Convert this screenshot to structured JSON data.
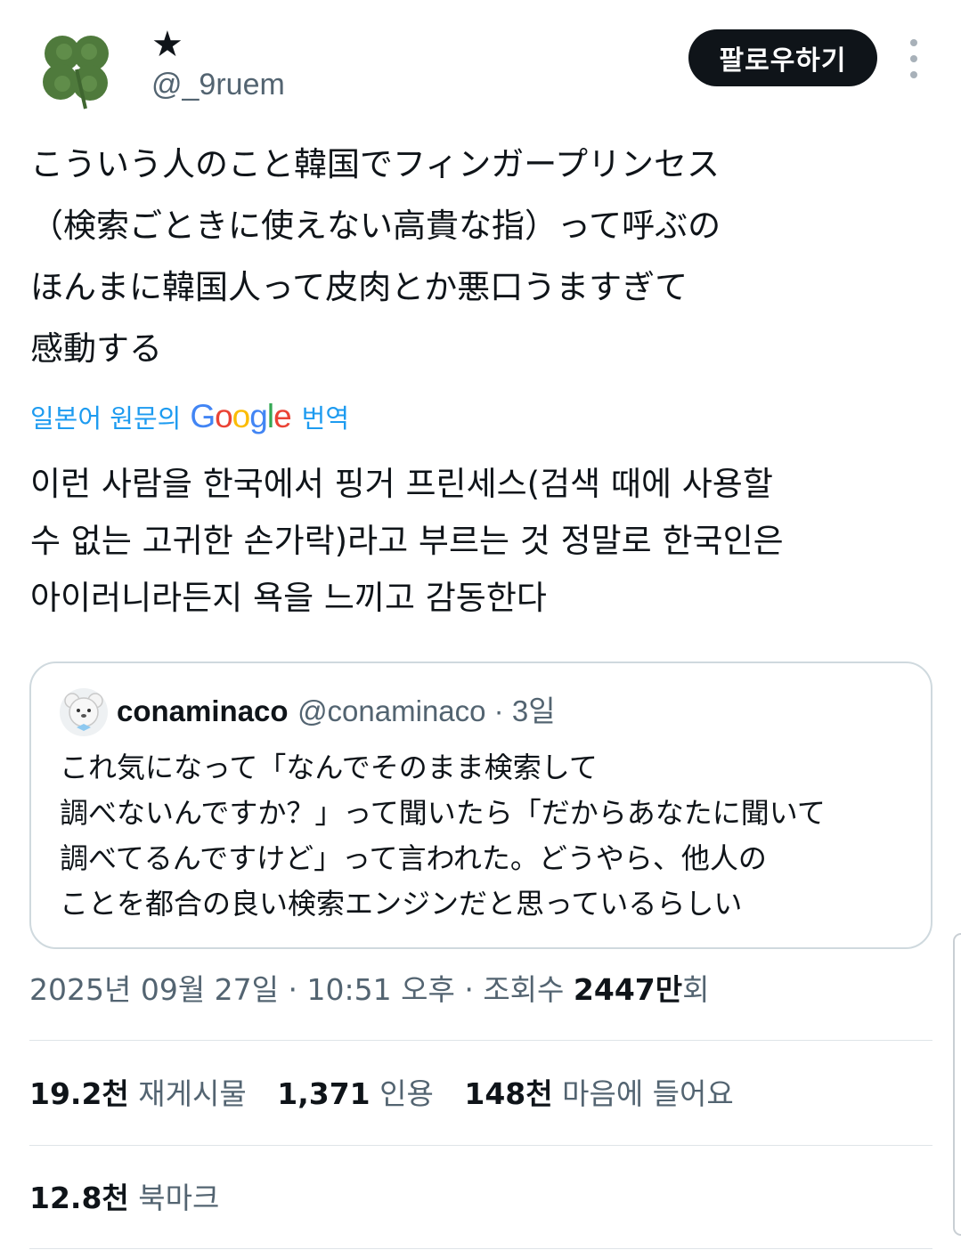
{
  "author": {
    "display_name": "★",
    "handle": "@_9ruem",
    "avatar_icon": "four-leaf-clover-icon"
  },
  "follow_label": "팔로우하기",
  "tweet_lines": [
    "こういう人のこと韓国でフィンガープリンセス",
    "（検索ごときに使えない高貴な指）って呼ぶの",
    "ほんまに韓国人って皮肉とか悪口うますぎて",
    "感動する"
  ],
  "translate": {
    "prefix": "일본어 원문의",
    "brand": "Google",
    "suffix": "번역"
  },
  "translation_lines": [
    "이런 사람을 한국에서 핑거 프린세스(검색 때에 사용할",
    "수 없는 고귀한 손가락)라고 부르는 것 정말로 한국인은",
    "아이러니라든지 욕을 느끼고 감동한다"
  ],
  "quote": {
    "name": "conaminaco",
    "handle": "@conaminaco",
    "separator": " · ",
    "time": "3일",
    "lines": [
      "これ気になって「なんでそのまま検索して",
      "調べないんですか？」って聞いたら「だからあなたに聞いて",
      "調べてるんですけど」って言われた。どうやら、他人の",
      "ことを都合の良い検索エンジンだと思っているらしい"
    ]
  },
  "meta": {
    "date": "2025년 09월 27일",
    "sep1": " · ",
    "time": "10:51 오후",
    "sep2": " · ",
    "views_label": "조회수 ",
    "views_value": "2447만",
    "views_unit": "회"
  },
  "stats": {
    "retweets_value": "19.2천",
    "retweets_label": "재게시물",
    "quotes_value": "1,371",
    "quotes_label": "인용",
    "likes_value": "148천",
    "likes_label": "마음에 들어요",
    "bookmarks_value": "12.8천",
    "bookmarks_label": "북마크"
  },
  "colors": {
    "text": "#0f1419",
    "secondary": "#536471",
    "link": "#1d9bf0",
    "border": "#cfd9de",
    "button": "#0f1419"
  }
}
